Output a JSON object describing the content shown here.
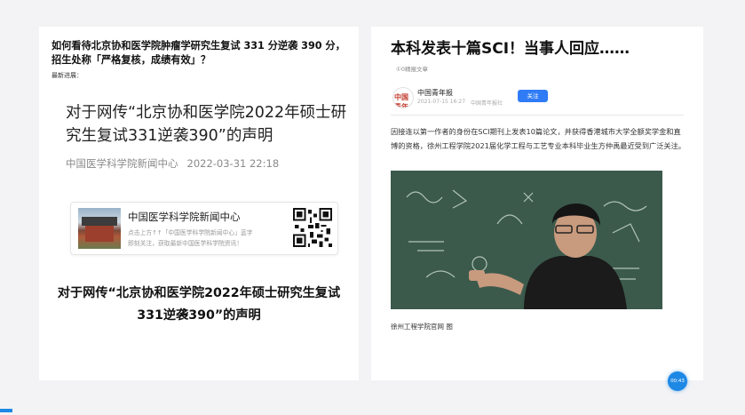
{
  "left": {
    "question_title": "如何看待北京协和医学院肿瘤学研究生复试 331 分逆袭 390 分，招生处称「严格复核，成绩有效」？",
    "latest_progress": "最新进展：",
    "statement_title": "对于网传“北京协和医学院2022年硕士研究生复试331逆袭390”的声明",
    "source": "中国医学科学院新闻中心",
    "date": "2022-03-31 22:18",
    "card": {
      "name": "中国医学科学院新闻中心",
      "line1": "点击上方↑↑「中国医学科学院新闻中心」蓝字",
      "line2": "即刻关注，获取最新中国医学科学院资讯！"
    },
    "bold_statement": "对于网传“北京协和医学院2022年硕士研究生复试331逆袭390”的声明"
  },
  "right": {
    "title": "本科发表十篇SCI！当事人回应……",
    "tag": "①0精报文章",
    "author": "中国青年报",
    "avatar_text": "中国青年报",
    "time": "2021-07-15 16:27",
    "from": "中国青年报社",
    "follow": "关注",
    "body": "因接连以第一作者的身份在SCI期刊上发表10篇论文，并获得香港城市大学全额奖学金和直博的资格，徐州工程学院2021届化学工程与工艺专业本科毕业生方仲禹最近受到广泛关注。",
    "caption": "徐州工程学院官网 图"
  },
  "timer": "00:43",
  "colors": {
    "accent": "#2f7cf6",
    "timer": "#1e88e5",
    "background": "#f3f3f5"
  }
}
